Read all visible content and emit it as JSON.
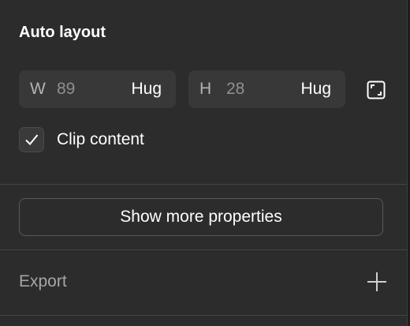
{
  "auto_layout": {
    "title": "Auto layout",
    "width": {
      "letter": "W",
      "value": "89",
      "mode": "Hug"
    },
    "height": {
      "letter": "H",
      "value": "28",
      "mode": "Hug"
    },
    "clip_content": {
      "label": "Clip content",
      "checked": true
    }
  },
  "show_more": {
    "label": "Show more properties"
  },
  "export": {
    "title": "Export"
  },
  "icons": {
    "resize": "resize-to-fit-icon",
    "checkmark": "checkmark-icon",
    "add": "plus-icon"
  },
  "colors": {
    "background": "#2c2c2c",
    "field": "#383838",
    "text": "#ffffff",
    "muted": "#8f8f8f"
  }
}
